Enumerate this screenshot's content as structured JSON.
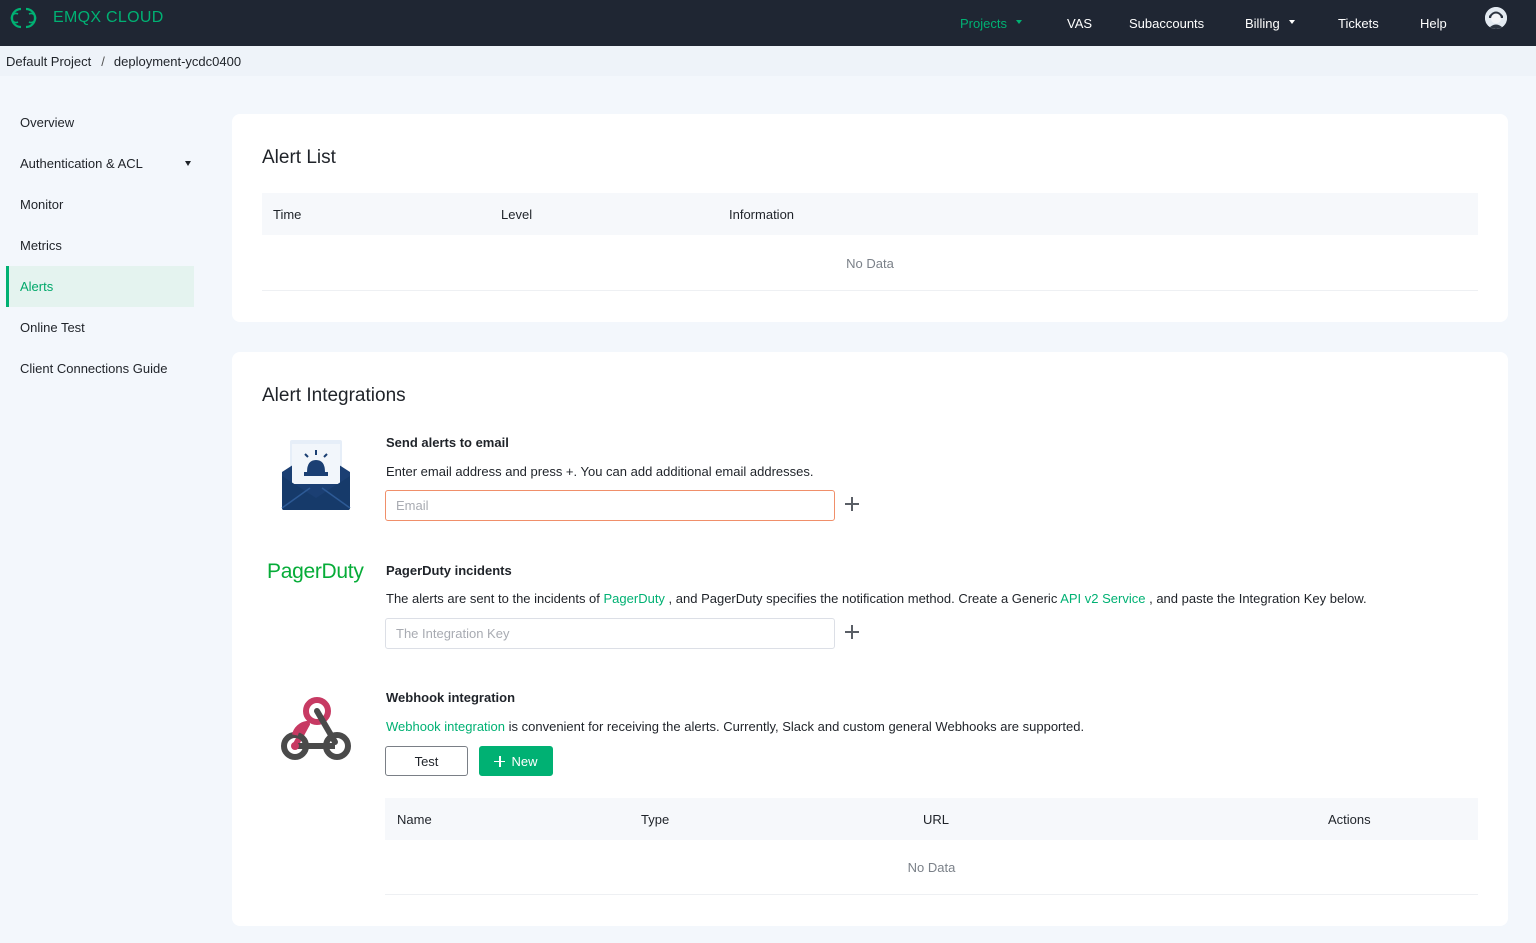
{
  "topbar": {
    "brand": "EMQX CLOUD",
    "nav": [
      {
        "label": "Projects"
      },
      {
        "label": "VAS"
      },
      {
        "label": "Subaccounts"
      },
      {
        "label": "Billing"
      },
      {
        "label": "Tickets"
      },
      {
        "label": "Help"
      }
    ],
    "accent_color": "#00b173",
    "background": "#1f2633"
  },
  "breadcrumb": {
    "project": "Default Project",
    "separator": "/",
    "deployment": "deployment-ycdc0400"
  },
  "sidebar": {
    "items": [
      {
        "label": "Overview"
      },
      {
        "label": "Authentication & ACL"
      },
      {
        "label": "Monitor"
      },
      {
        "label": "Metrics"
      },
      {
        "label": "Alerts",
        "active": true
      },
      {
        "label": "Online Test"
      },
      {
        "label": "Client Connections Guide"
      }
    ]
  },
  "alert_list": {
    "title": "Alert List",
    "columns": [
      "Time",
      "Level",
      "Information"
    ],
    "empty_text": "No Data"
  },
  "alert_integrations": {
    "title": "Alert Integrations",
    "email": {
      "title": "Send alerts to email",
      "description": "Enter email address and press +. You can add additional email addresses.",
      "placeholder": "Email",
      "icon": "envelope-alarm-icon"
    },
    "pagerduty": {
      "logo_text": "PagerDuty",
      "title": "PagerDuty incidents",
      "desc_1": "The alerts are sent to the incidents of ",
      "link_1": "PagerDuty",
      "desc_2": " , and PagerDuty specifies the notification method. Create a Generic ",
      "link_2": "API v2 Service",
      "desc_3": " , and paste the Integration Key below.",
      "placeholder": "The Integration Key"
    },
    "webhook": {
      "title": "Webhook integration",
      "link": "Webhook integration",
      "description": " is convenient for receiving the alerts. Currently, Slack and custom general Webhooks are supported.",
      "test_label": "Test",
      "new_label": "New",
      "icon": "webhook-icon",
      "columns": [
        "Name",
        "Type",
        "URL",
        "Actions"
      ],
      "empty_text": "No Data"
    }
  }
}
